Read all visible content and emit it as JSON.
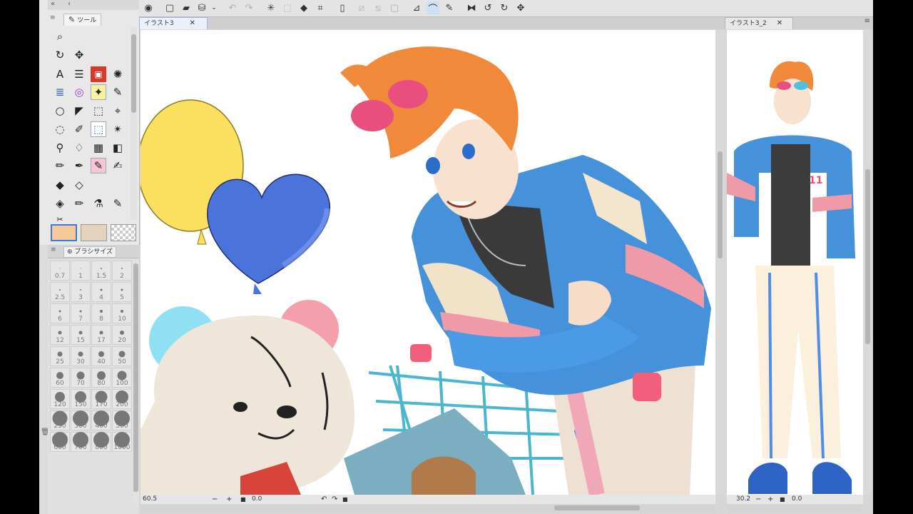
{
  "tool_palette": {
    "tab_label": "ツール",
    "colors": {
      "main": "#f6c89a",
      "sub": "#e6d3bd"
    }
  },
  "brush_size": {
    "tab_label": "ブラシサイズ",
    "sizes": [
      "0.7",
      "1",
      "1.5",
      "2",
      "2.5",
      "3",
      "4",
      "5",
      "6",
      "7",
      "8",
      "10",
      "12",
      "15",
      "17",
      "20",
      "25",
      "30",
      "40",
      "50",
      "60",
      "70",
      "80",
      "100",
      "120",
      "150",
      "170",
      "200",
      "250",
      "300",
      "400",
      "500",
      "600",
      "700",
      "800",
      "1000"
    ]
  },
  "canvas1": {
    "tab_label": "イラスト3",
    "zoom": "60.5",
    "rotation": "0.0"
  },
  "canvas2": {
    "tab_label": "イラスト3_2",
    "zoom": "30.2",
    "rotation": "0.0"
  },
  "icons": [
    "logo-icon",
    "new-icon",
    "open-icon",
    "save-icon",
    "undo-icon",
    "redo-icon",
    "magnifier-icon",
    "pen-icon",
    "brush-icon",
    "airbrush-icon",
    "fill-icon",
    "eraser-icon",
    "text-icon",
    "selection-icon",
    "transform-icon",
    "flip-icon",
    "rotate-icon"
  ]
}
